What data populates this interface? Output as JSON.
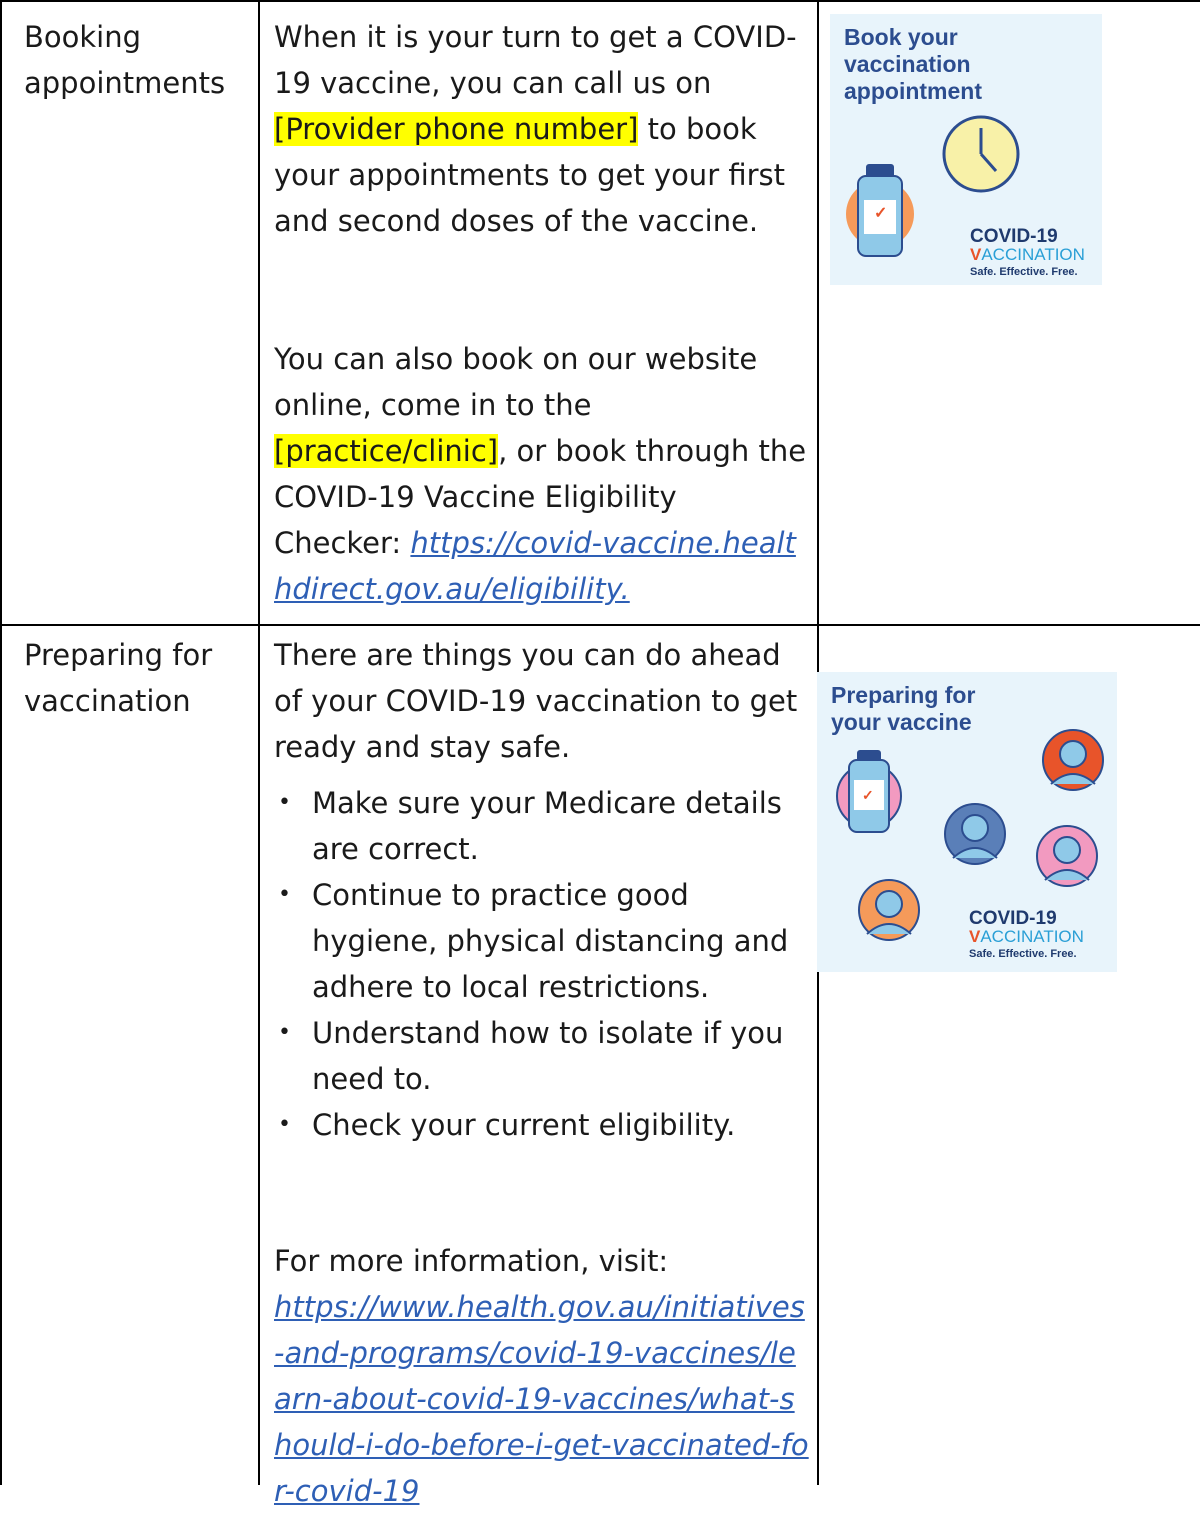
{
  "rows": [
    {
      "label": "Booking appointments",
      "content": {
        "p1_part1": "When it is your turn to get a COVID-19 vaccine, you can call us on ",
        "p1_highlight": "[Provider phone number]",
        "p1_part2": " to book your appointments to get your first and second doses of the vaccine.",
        "p2_part1": "You can also book on our website online, come in to the ",
        "p2_highlight": "[practice/clinic]",
        "p2_part2": ", or book through the COVID-19 Vaccine Eligibility Checker: ",
        "link": "https://covid-vaccine.healthdirect.gov.au/eligibility."
      },
      "image": {
        "title_line1": "Book your",
        "title_line2": "vaccination",
        "title_line3": "appointment",
        "icons": [
          "vaccine-vial-icon",
          "clock-icon"
        ]
      }
    },
    {
      "label": "Preparing for vaccination",
      "content": {
        "intro": "There are things you can do ahead of your COVID-19 vaccination to get ready and stay safe.",
        "bullets": [
          "Make sure your Medicare details are correct.",
          "Continue to practice good hygiene, physical distancing and adhere to local restrictions.",
          "Understand how to isolate if you need to.",
          "Check your current eligibility."
        ],
        "more_info": "For more information, visit:",
        "link": "https://www.health.gov.au/initiatives-and-programs/covid-19-vaccines/learn-about-covid-19-vaccines/what-should-i-do-before-i-get-vaccinated-for-covid-19"
      },
      "image": {
        "title_line1": "Preparing for",
        "title_line2": "your vaccine",
        "icons": [
          "vaccine-vial-icon",
          "person-avatar-icon"
        ]
      }
    }
  ],
  "brand": {
    "line1": "COVID-19",
    "line2_v": "V",
    "line2_rest": "ACCINATION",
    "tagline": "Safe. Effective. Free."
  },
  "colors": {
    "highlight": "#ffff00",
    "link": "#2e5fb5",
    "promo_bg": "#e8f4fb",
    "promo_title": "#2c4d8f",
    "accent_orange": "#e8542a",
    "accent_blue": "#2a9fd6"
  }
}
